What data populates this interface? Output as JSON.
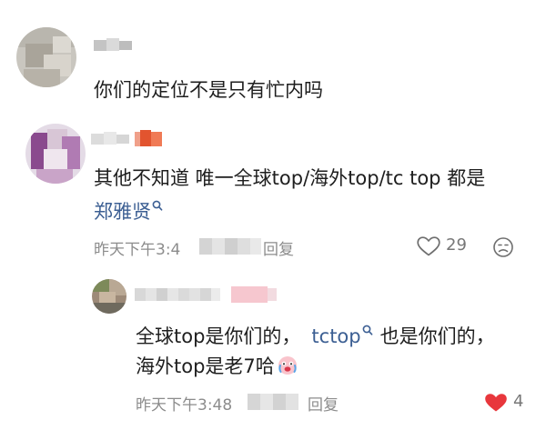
{
  "comments": [
    {
      "body": "你们的定位不是只有忙内吗"
    },
    {
      "body_line1": "其他不知道  唯一全球top/海外top/tc top 都是",
      "body_mention": "郑雅贤",
      "time_partial": "昨天下午3:4",
      "reply_partial": "回复",
      "like_count": "29",
      "reply": {
        "line1_a": "全球top是你们的，",
        "mention": "tctop",
        "line1_b": "也是你们的，",
        "line2": "海外top是老7哈",
        "time": "昨天下午3:48",
        "reply_label": "回复",
        "like_count": "4",
        "liked_color": "#e8373c"
      }
    }
  ],
  "icons": {
    "like": "heart-icon",
    "liked": "heart-filled-icon",
    "dislike": "dislike-face-icon",
    "mention": "search-link-icon",
    "emoji": "crying-emoji-icon"
  }
}
